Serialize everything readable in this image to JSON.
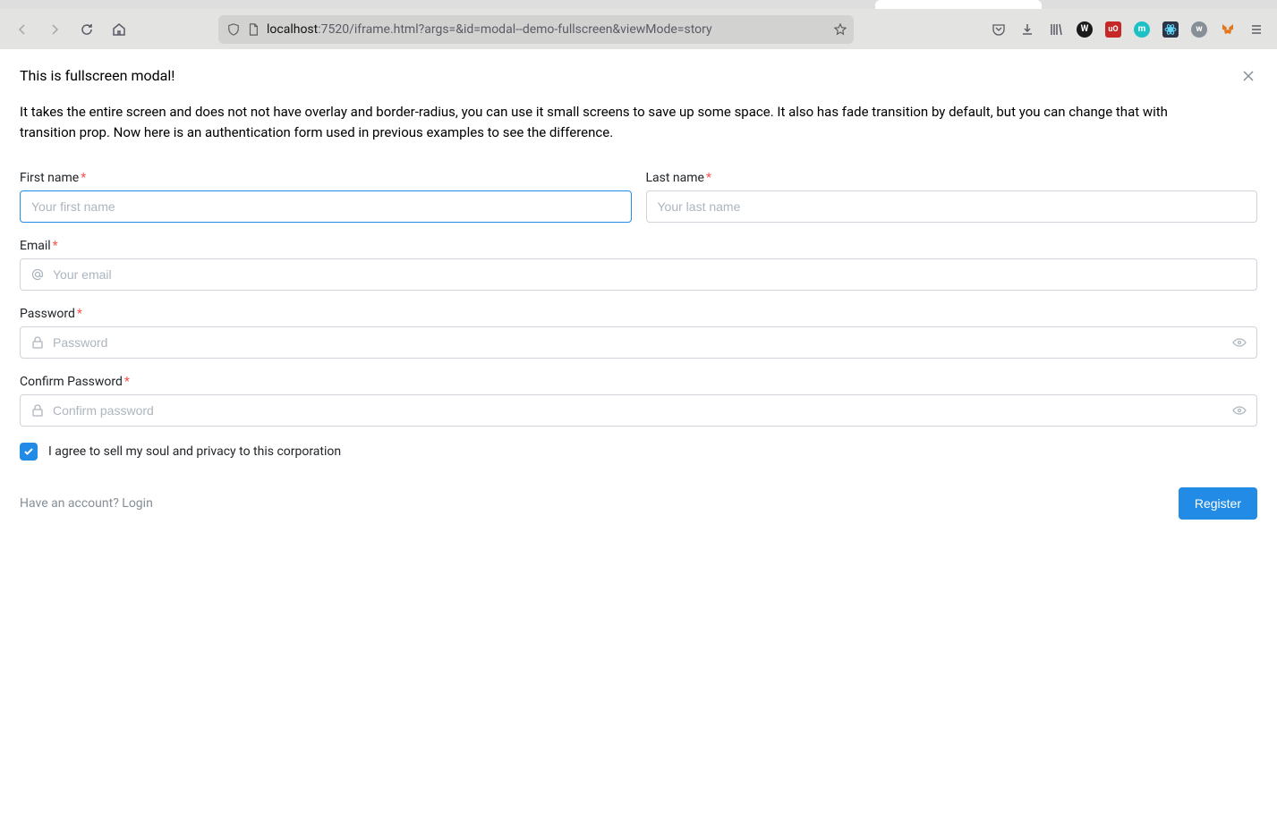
{
  "browser": {
    "url_host": "localhost",
    "url_rest": ":7520/iframe.html?args=&id=modal--demo-fullscreen&viewMode=story"
  },
  "modal": {
    "title": "This is fullscreen modal!",
    "description": "It takes the entire screen and does not not have overlay and border-radius, you can use it small screens to save up some space. It also has fade transition by default, but you can change that with transition prop. Now here is an authentication form used in previous examples to see the difference."
  },
  "form": {
    "first_name": {
      "label": "First name",
      "placeholder": "Your first name",
      "value": ""
    },
    "last_name": {
      "label": "Last name",
      "placeholder": "Your last name",
      "value": ""
    },
    "email": {
      "label": "Email",
      "placeholder": "Your email",
      "value": ""
    },
    "password": {
      "label": "Password",
      "placeholder": "Password",
      "value": ""
    },
    "confirm": {
      "label": "Confirm Password",
      "placeholder": "Confirm password",
      "value": ""
    },
    "checkbox": {
      "label": "I agree to sell my soul and privacy to this corporation",
      "checked": true
    },
    "login_link": "Have an account? Login",
    "register": "Register"
  }
}
